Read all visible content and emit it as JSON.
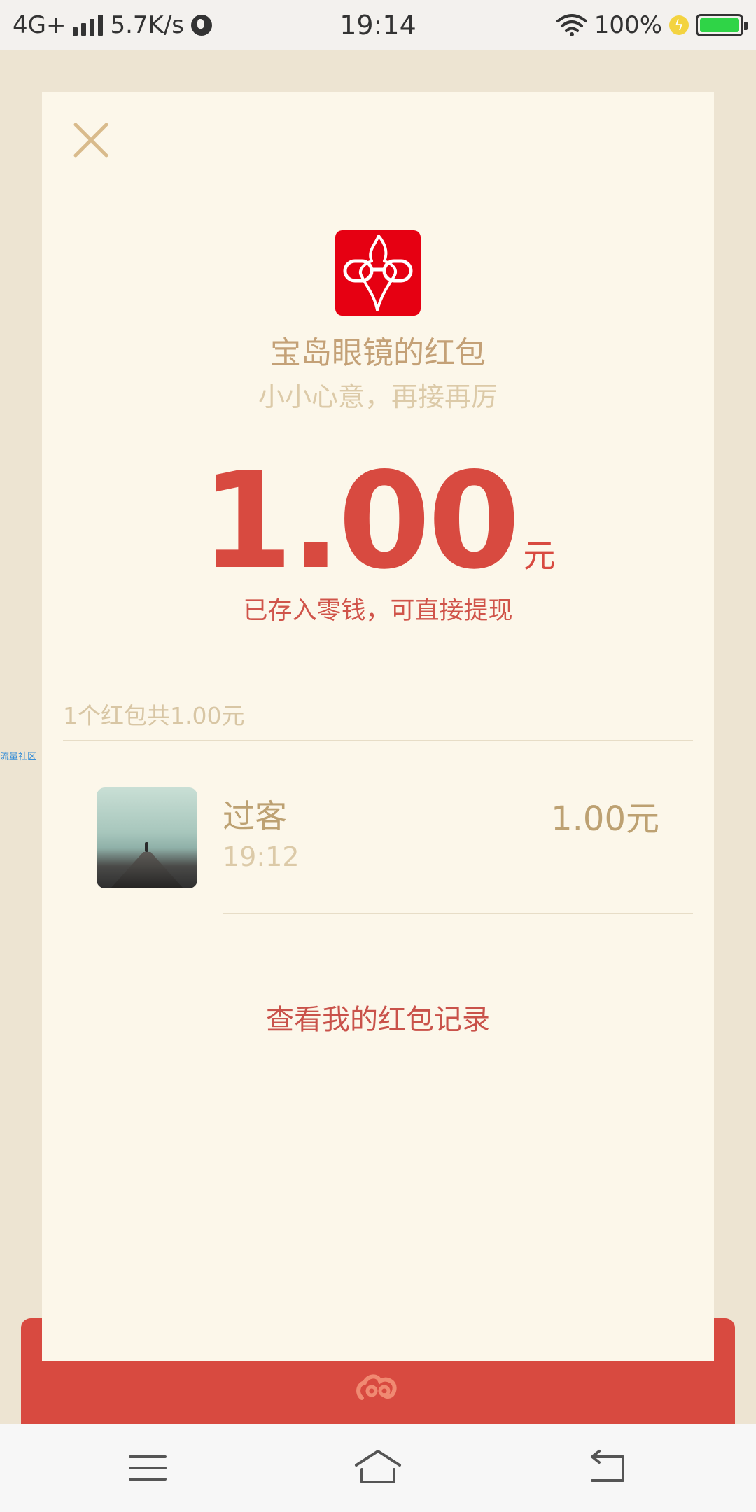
{
  "status_bar": {
    "network": "4G+",
    "speed": "5.7K/s",
    "time": "19:14",
    "battery": "100%"
  },
  "side_tag": "流量社区",
  "header": {
    "sender_title": "宝岛眼镜的红包",
    "wish": "小小心意，再接再厉"
  },
  "amount": {
    "value": "1.00",
    "unit": "元",
    "note": "已存入零钱，可直接提现"
  },
  "summary": "1个红包共1.00元",
  "records": [
    {
      "name": "过客",
      "time": "19:12",
      "amount": "1.00元"
    }
  ],
  "footer_link": "查看我的红包记录",
  "colors": {
    "accent_red": "#d84a40",
    "gold_text": "#c4a177",
    "paper": "#fcf7ea",
    "logo_red": "#e60012"
  },
  "icons": [
    "close-icon",
    "optical-shop-logo",
    "menu-icon",
    "home-icon",
    "back-icon",
    "cloud-swirl-icon"
  ]
}
